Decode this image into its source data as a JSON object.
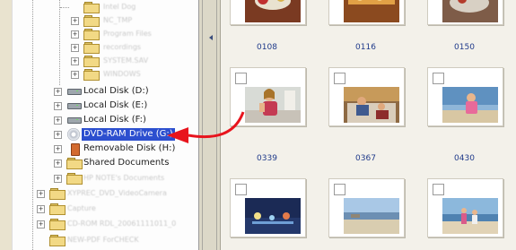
{
  "tree": {
    "items": [
      {
        "label": "Intel Dog",
        "icon": "folder-icon"
      },
      {
        "label": "NC_TMP",
        "icon": "folder-icon"
      },
      {
        "label": "Program Files",
        "icon": "folder-icon"
      },
      {
        "label": "recordings",
        "icon": "folder-icon"
      },
      {
        "label": "SYSTEM.SAV",
        "icon": "folder-icon"
      },
      {
        "label": "WINDOWS",
        "icon": "folder-icon"
      },
      {
        "label": "Local Disk (D:)",
        "icon": "hard-drive-icon"
      },
      {
        "label": "Local Disk (E:)",
        "icon": "hard-drive-icon"
      },
      {
        "label": "Local Disk (F:)",
        "icon": "hard-drive-icon"
      },
      {
        "label": "DVD-RAM Drive (G:)",
        "icon": "dvd-drive-icon",
        "selected": true
      },
      {
        "label": "Removable Disk (H:)",
        "icon": "removable-disk-icon"
      },
      {
        "label": "Shared Documents",
        "icon": "folder-icon"
      },
      {
        "label": "HP NOTE's Documents",
        "icon": "folder-icon"
      },
      {
        "label": "XYPREC_DVD_VideoCamera",
        "icon": "folder-icon"
      },
      {
        "label": "Capture",
        "icon": "folder-icon"
      },
      {
        "label": "CD-ROM RDL_20061111011_0",
        "icon": "folder-icon"
      },
      {
        "label": "NEW-PDF ForCHECK",
        "icon": "folder-icon"
      }
    ]
  },
  "thumbnails": [
    {
      "label": "0108"
    },
    {
      "label": "0116"
    },
    {
      "label": "0150"
    },
    {
      "label": "0339"
    },
    {
      "label": "0367"
    },
    {
      "label": "0430"
    },
    {
      "label": ""
    },
    {
      "label": ""
    },
    {
      "label": ""
    }
  ],
  "colors": {
    "selection": "#2c4fcf",
    "callout_arrow": "#e8141d",
    "thumb_label": "#1f3a8a"
  }
}
